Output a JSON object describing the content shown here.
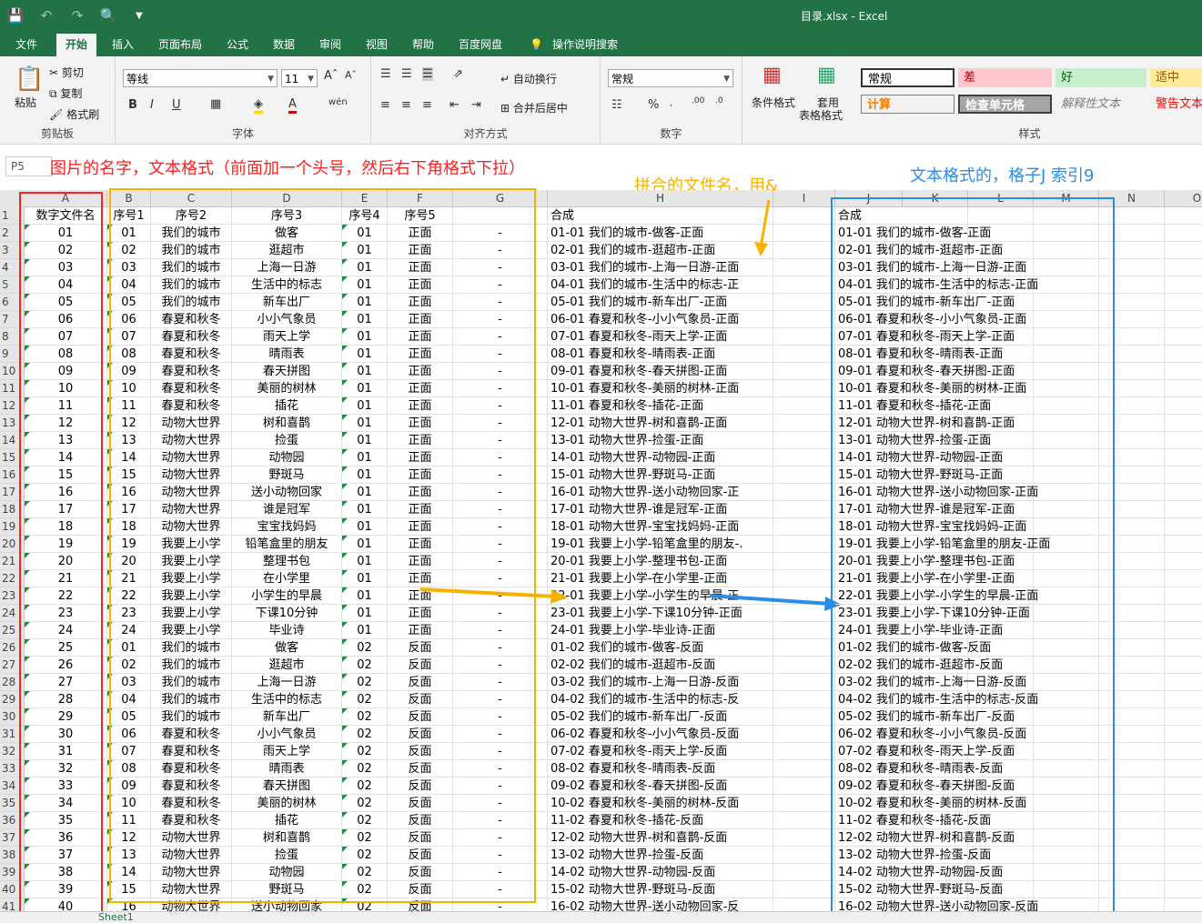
{
  "window": {
    "title": "目录.xlsx  -  Excel"
  },
  "qat": {
    "icons": [
      "save-icon",
      "undo-icon",
      "redo-icon",
      "print-preview-icon",
      "customize-icon"
    ]
  },
  "tabs": [
    "文件",
    "开始",
    "插入",
    "页面布局",
    "公式",
    "数据",
    "审阅",
    "视图",
    "帮助",
    "百度网盘",
    "操作说明搜索"
  ],
  "ribbon": {
    "clipboard": {
      "paste": "粘贴",
      "cut": "剪切",
      "copy": "复制",
      "format_painter": "格式刷",
      "label": "剪贴板"
    },
    "font": {
      "name": "等线",
      "size": "11",
      "label": "字体",
      "bold": "B",
      "italic": "I",
      "underline": "U"
    },
    "align": {
      "wrap": "自动换行",
      "merge": "合并后居中",
      "label": "对齐方式"
    },
    "number": {
      "format": "常规",
      "percent": "%",
      "label": "数字"
    },
    "styles_btns": {
      "cond": "条件格式",
      "table1": "套用",
      "table2": "表格格式"
    },
    "styles": {
      "normal": "常规",
      "bad": "差",
      "good": "好",
      "neutral": "适中",
      "calc": "计算",
      "check": "检查单元格",
      "explain": "解释性文本",
      "warn": "警告文本",
      "label": "样式"
    }
  },
  "namebox": "P5",
  "annotations": {
    "red": "图片的名字，文本格式（前面加一个头号，然后右下角格式下拉）",
    "orange": "拼合的文件名，用&",
    "blue": "文本格式的，格子J 索引9"
  },
  "columns": [
    "A",
    "B",
    "C",
    "D",
    "E",
    "F",
    "G",
    "H",
    "I",
    "J",
    "K",
    "L",
    "M",
    "N",
    "O"
  ],
  "headers": {
    "a": "数字文件名",
    "b": "序号1",
    "c": "序号2",
    "d": "序号3",
    "e": "序号4",
    "f": "序号5",
    "h": "合成",
    "j": "合成"
  },
  "rows": [
    {
      "a": "01",
      "b": "01",
      "c": "我们的城市",
      "d": "做客",
      "e": "01",
      "f": "正面",
      "g": "-",
      "h": "01-01 我们的城市-做客-正面",
      "j": "01-01 我们的城市-做客-正面"
    },
    {
      "a": "02",
      "b": "02",
      "c": "我们的城市",
      "d": "逛超市",
      "e": "01",
      "f": "正面",
      "g": "-",
      "h": "02-01 我们的城市-逛超市-正面",
      "j": "02-01 我们的城市-逛超市-正面"
    },
    {
      "a": "03",
      "b": "03",
      "c": "我们的城市",
      "d": "上海一日游",
      "e": "01",
      "f": "正面",
      "g": "-",
      "h": "03-01 我们的城市-上海一日游-正面",
      "j": "03-01 我们的城市-上海一日游-正面"
    },
    {
      "a": "04",
      "b": "04",
      "c": "我们的城市",
      "d": "生活中的标志",
      "e": "01",
      "f": "正面",
      "g": "-",
      "h": "04-01 我们的城市-生活中的标志-正",
      "j": "04-01 我们的城市-生活中的标志-正面"
    },
    {
      "a": "05",
      "b": "05",
      "c": "我们的城市",
      "d": "新车出厂",
      "e": "01",
      "f": "正面",
      "g": "-",
      "h": "05-01 我们的城市-新车出厂-正面",
      "j": "05-01 我们的城市-新车出厂-正面"
    },
    {
      "a": "06",
      "b": "06",
      "c": "春夏和秋冬",
      "d": "小小气象员",
      "e": "01",
      "f": "正面",
      "g": "-",
      "h": "06-01 春夏和秋冬-小小气象员-正面",
      "j": "06-01 春夏和秋冬-小小气象员-正面"
    },
    {
      "a": "07",
      "b": "07",
      "c": "春夏和秋冬",
      "d": "雨天上学",
      "e": "01",
      "f": "正面",
      "g": "-",
      "h": "07-01 春夏和秋冬-雨天上学-正面",
      "j": "07-01 春夏和秋冬-雨天上学-正面"
    },
    {
      "a": "08",
      "b": "08",
      "c": "春夏和秋冬",
      "d": "晴雨表",
      "e": "01",
      "f": "正面",
      "g": "-",
      "h": "08-01 春夏和秋冬-晴雨表-正面",
      "j": "08-01 春夏和秋冬-晴雨表-正面"
    },
    {
      "a": "09",
      "b": "09",
      "c": "春夏和秋冬",
      "d": "春天拼图",
      "e": "01",
      "f": "正面",
      "g": "-",
      "h": "09-01 春夏和秋冬-春天拼图-正面",
      "j": "09-01 春夏和秋冬-春天拼图-正面"
    },
    {
      "a": "10",
      "b": "10",
      "c": "春夏和秋冬",
      "d": "美丽的树林",
      "e": "01",
      "f": "正面",
      "g": "-",
      "h": "10-01 春夏和秋冬-美丽的树林-正面",
      "j": "10-01 春夏和秋冬-美丽的树林-正面"
    },
    {
      "a": "11",
      "b": "11",
      "c": "春夏和秋冬",
      "d": "插花",
      "e": "01",
      "f": "正面",
      "g": "-",
      "h": "11-01 春夏和秋冬-插花-正面",
      "j": "11-01 春夏和秋冬-插花-正面"
    },
    {
      "a": "12",
      "b": "12",
      "c": "动物大世界",
      "d": "树和喜鹊",
      "e": "01",
      "f": "正面",
      "g": "-",
      "h": "12-01 动物大世界-树和喜鹊-正面",
      "j": "12-01 动物大世界-树和喜鹊-正面"
    },
    {
      "a": "13",
      "b": "13",
      "c": "动物大世界",
      "d": "捡蛋",
      "e": "01",
      "f": "正面",
      "g": "-",
      "h": "13-01 动物大世界-捡蛋-正面",
      "j": "13-01 动物大世界-捡蛋-正面"
    },
    {
      "a": "14",
      "b": "14",
      "c": "动物大世界",
      "d": "动物园",
      "e": "01",
      "f": "正面",
      "g": "-",
      "h": "14-01 动物大世界-动物园-正面",
      "j": "14-01 动物大世界-动物园-正面"
    },
    {
      "a": "15",
      "b": "15",
      "c": "动物大世界",
      "d": "野斑马",
      "e": "01",
      "f": "正面",
      "g": "-",
      "h": "15-01 动物大世界-野斑马-正面",
      "j": "15-01 动物大世界-野斑马-正面"
    },
    {
      "a": "16",
      "b": "16",
      "c": "动物大世界",
      "d": "送小动物回家",
      "e": "01",
      "f": "正面",
      "g": "-",
      "h": "16-01 动物大世界-送小动物回家-正",
      "j": "16-01 动物大世界-送小动物回家-正面"
    },
    {
      "a": "17",
      "b": "17",
      "c": "动物大世界",
      "d": "谁是冠军",
      "e": "01",
      "f": "正面",
      "g": "-",
      "h": "17-01 动物大世界-谁是冠军-正面",
      "j": "17-01 动物大世界-谁是冠军-正面"
    },
    {
      "a": "18",
      "b": "18",
      "c": "动物大世界",
      "d": "宝宝找妈妈",
      "e": "01",
      "f": "正面",
      "g": "-",
      "h": "18-01 动物大世界-宝宝找妈妈-正面",
      "j": "18-01 动物大世界-宝宝找妈妈-正面"
    },
    {
      "a": "19",
      "b": "19",
      "c": "我要上小学",
      "d": "铅笔盒里的朋友",
      "e": "01",
      "f": "正面",
      "g": "-",
      "h": "19-01 我要上小学-铅笔盒里的朋友-.",
      "j": "19-01 我要上小学-铅笔盒里的朋友-正面"
    },
    {
      "a": "20",
      "b": "20",
      "c": "我要上小学",
      "d": "整理书包",
      "e": "01",
      "f": "正面",
      "g": "-",
      "h": "20-01 我要上小学-整理书包-正面",
      "j": "20-01 我要上小学-整理书包-正面"
    },
    {
      "a": "21",
      "b": "21",
      "c": "我要上小学",
      "d": "在小学里",
      "e": "01",
      "f": "正面",
      "g": "-",
      "h": "21-01 我要上小学-在小学里-正面",
      "j": "21-01 我要上小学-在小学里-正面"
    },
    {
      "a": "22",
      "b": "22",
      "c": "我要上小学",
      "d": "小学生的早晨",
      "e": "01",
      "f": "正面",
      "g": "-",
      "h": "22-01 我要上小学-小学生的早晨-正",
      "j": "22-01 我要上小学-小学生的早晨-正面"
    },
    {
      "a": "23",
      "b": "23",
      "c": "我要上小学",
      "d": "下课10分钟",
      "e": "01",
      "f": "正面",
      "g": "-",
      "h": "23-01 我要上小学-下课10分钟-正面",
      "j": "23-01 我要上小学-下课10分钟-正面"
    },
    {
      "a": "24",
      "b": "24",
      "c": "我要上小学",
      "d": "毕业诗",
      "e": "01",
      "f": "正面",
      "g": "-",
      "h": "24-01 我要上小学-毕业诗-正面",
      "j": "24-01 我要上小学-毕业诗-正面"
    },
    {
      "a": "25",
      "b": "01",
      "c": "我们的城市",
      "d": "做客",
      "e": "02",
      "f": "反面",
      "g": "-",
      "h": "01-02 我们的城市-做客-反面",
      "j": "01-02 我们的城市-做客-反面"
    },
    {
      "a": "26",
      "b": "02",
      "c": "我们的城市",
      "d": "逛超市",
      "e": "02",
      "f": "反面",
      "g": "-",
      "h": "02-02 我们的城市-逛超市-反面",
      "j": "02-02 我们的城市-逛超市-反面"
    },
    {
      "a": "27",
      "b": "03",
      "c": "我们的城市",
      "d": "上海一日游",
      "e": "02",
      "f": "反面",
      "g": "-",
      "h": "03-02 我们的城市-上海一日游-反面",
      "j": "03-02 我们的城市-上海一日游-反面"
    },
    {
      "a": "28",
      "b": "04",
      "c": "我们的城市",
      "d": "生活中的标志",
      "e": "02",
      "f": "反面",
      "g": "-",
      "h": "04-02 我们的城市-生活中的标志-反",
      "j": "04-02 我们的城市-生活中的标志-反面"
    },
    {
      "a": "29",
      "b": "05",
      "c": "我们的城市",
      "d": "新车出厂",
      "e": "02",
      "f": "反面",
      "g": "-",
      "h": "05-02 我们的城市-新车出厂-反面",
      "j": "05-02 我们的城市-新车出厂-反面"
    },
    {
      "a": "30",
      "b": "06",
      "c": "春夏和秋冬",
      "d": "小小气象员",
      "e": "02",
      "f": "反面",
      "g": "-",
      "h": "06-02 春夏和秋冬-小小气象员-反面",
      "j": "06-02 春夏和秋冬-小小气象员-反面"
    },
    {
      "a": "31",
      "b": "07",
      "c": "春夏和秋冬",
      "d": "雨天上学",
      "e": "02",
      "f": "反面",
      "g": "-",
      "h": "07-02 春夏和秋冬-雨天上学-反面",
      "j": "07-02 春夏和秋冬-雨天上学-反面"
    },
    {
      "a": "32",
      "b": "08",
      "c": "春夏和秋冬",
      "d": "晴雨表",
      "e": "02",
      "f": "反面",
      "g": "-",
      "h": "08-02 春夏和秋冬-晴雨表-反面",
      "j": "08-02 春夏和秋冬-晴雨表-反面"
    },
    {
      "a": "33",
      "b": "09",
      "c": "春夏和秋冬",
      "d": "春天拼图",
      "e": "02",
      "f": "反面",
      "g": "-",
      "h": "09-02 春夏和秋冬-春天拼图-反面",
      "j": "09-02 春夏和秋冬-春天拼图-反面"
    },
    {
      "a": "34",
      "b": "10",
      "c": "春夏和秋冬",
      "d": "美丽的树林",
      "e": "02",
      "f": "反面",
      "g": "-",
      "h": "10-02 春夏和秋冬-美丽的树林-反面",
      "j": "10-02 春夏和秋冬-美丽的树林-反面"
    },
    {
      "a": "35",
      "b": "11",
      "c": "春夏和秋冬",
      "d": "插花",
      "e": "02",
      "f": "反面",
      "g": "-",
      "h": "11-02 春夏和秋冬-插花-反面",
      "j": "11-02 春夏和秋冬-插花-反面"
    },
    {
      "a": "36",
      "b": "12",
      "c": "动物大世界",
      "d": "树和喜鹊",
      "e": "02",
      "f": "反面",
      "g": "-",
      "h": "12-02 动物大世界-树和喜鹊-反面",
      "j": "12-02 动物大世界-树和喜鹊-反面"
    },
    {
      "a": "37",
      "b": "13",
      "c": "动物大世界",
      "d": "捡蛋",
      "e": "02",
      "f": "反面",
      "g": "-",
      "h": "13-02 动物大世界-捡蛋-反面",
      "j": "13-02 动物大世界-捡蛋-反面"
    },
    {
      "a": "38",
      "b": "14",
      "c": "动物大世界",
      "d": "动物园",
      "e": "02",
      "f": "反面",
      "g": "-",
      "h": "14-02 动物大世界-动物园-反面",
      "j": "14-02 动物大世界-动物园-反面"
    },
    {
      "a": "39",
      "b": "15",
      "c": "动物大世界",
      "d": "野斑马",
      "e": "02",
      "f": "反面",
      "g": "-",
      "h": "15-02 动物大世界-野斑马-反面",
      "j": "15-02 动物大世界-野斑马-反面"
    },
    {
      "a": "40",
      "b": "16",
      "c": "动物大世界",
      "d": "送小动物回家",
      "e": "02",
      "f": "反面",
      "g": "-",
      "h": "16-02 动物大世界-送小动物回家-反",
      "j": "16-02 动物大世界-送小动物回家-反面"
    }
  ],
  "sheet_tab": "Sheet1",
  "colors": {
    "excel_green": "#217346",
    "annotation_red": "#ff2020",
    "annotation_orange": "#f5b300",
    "annotation_blue": "#2b8de8"
  }
}
